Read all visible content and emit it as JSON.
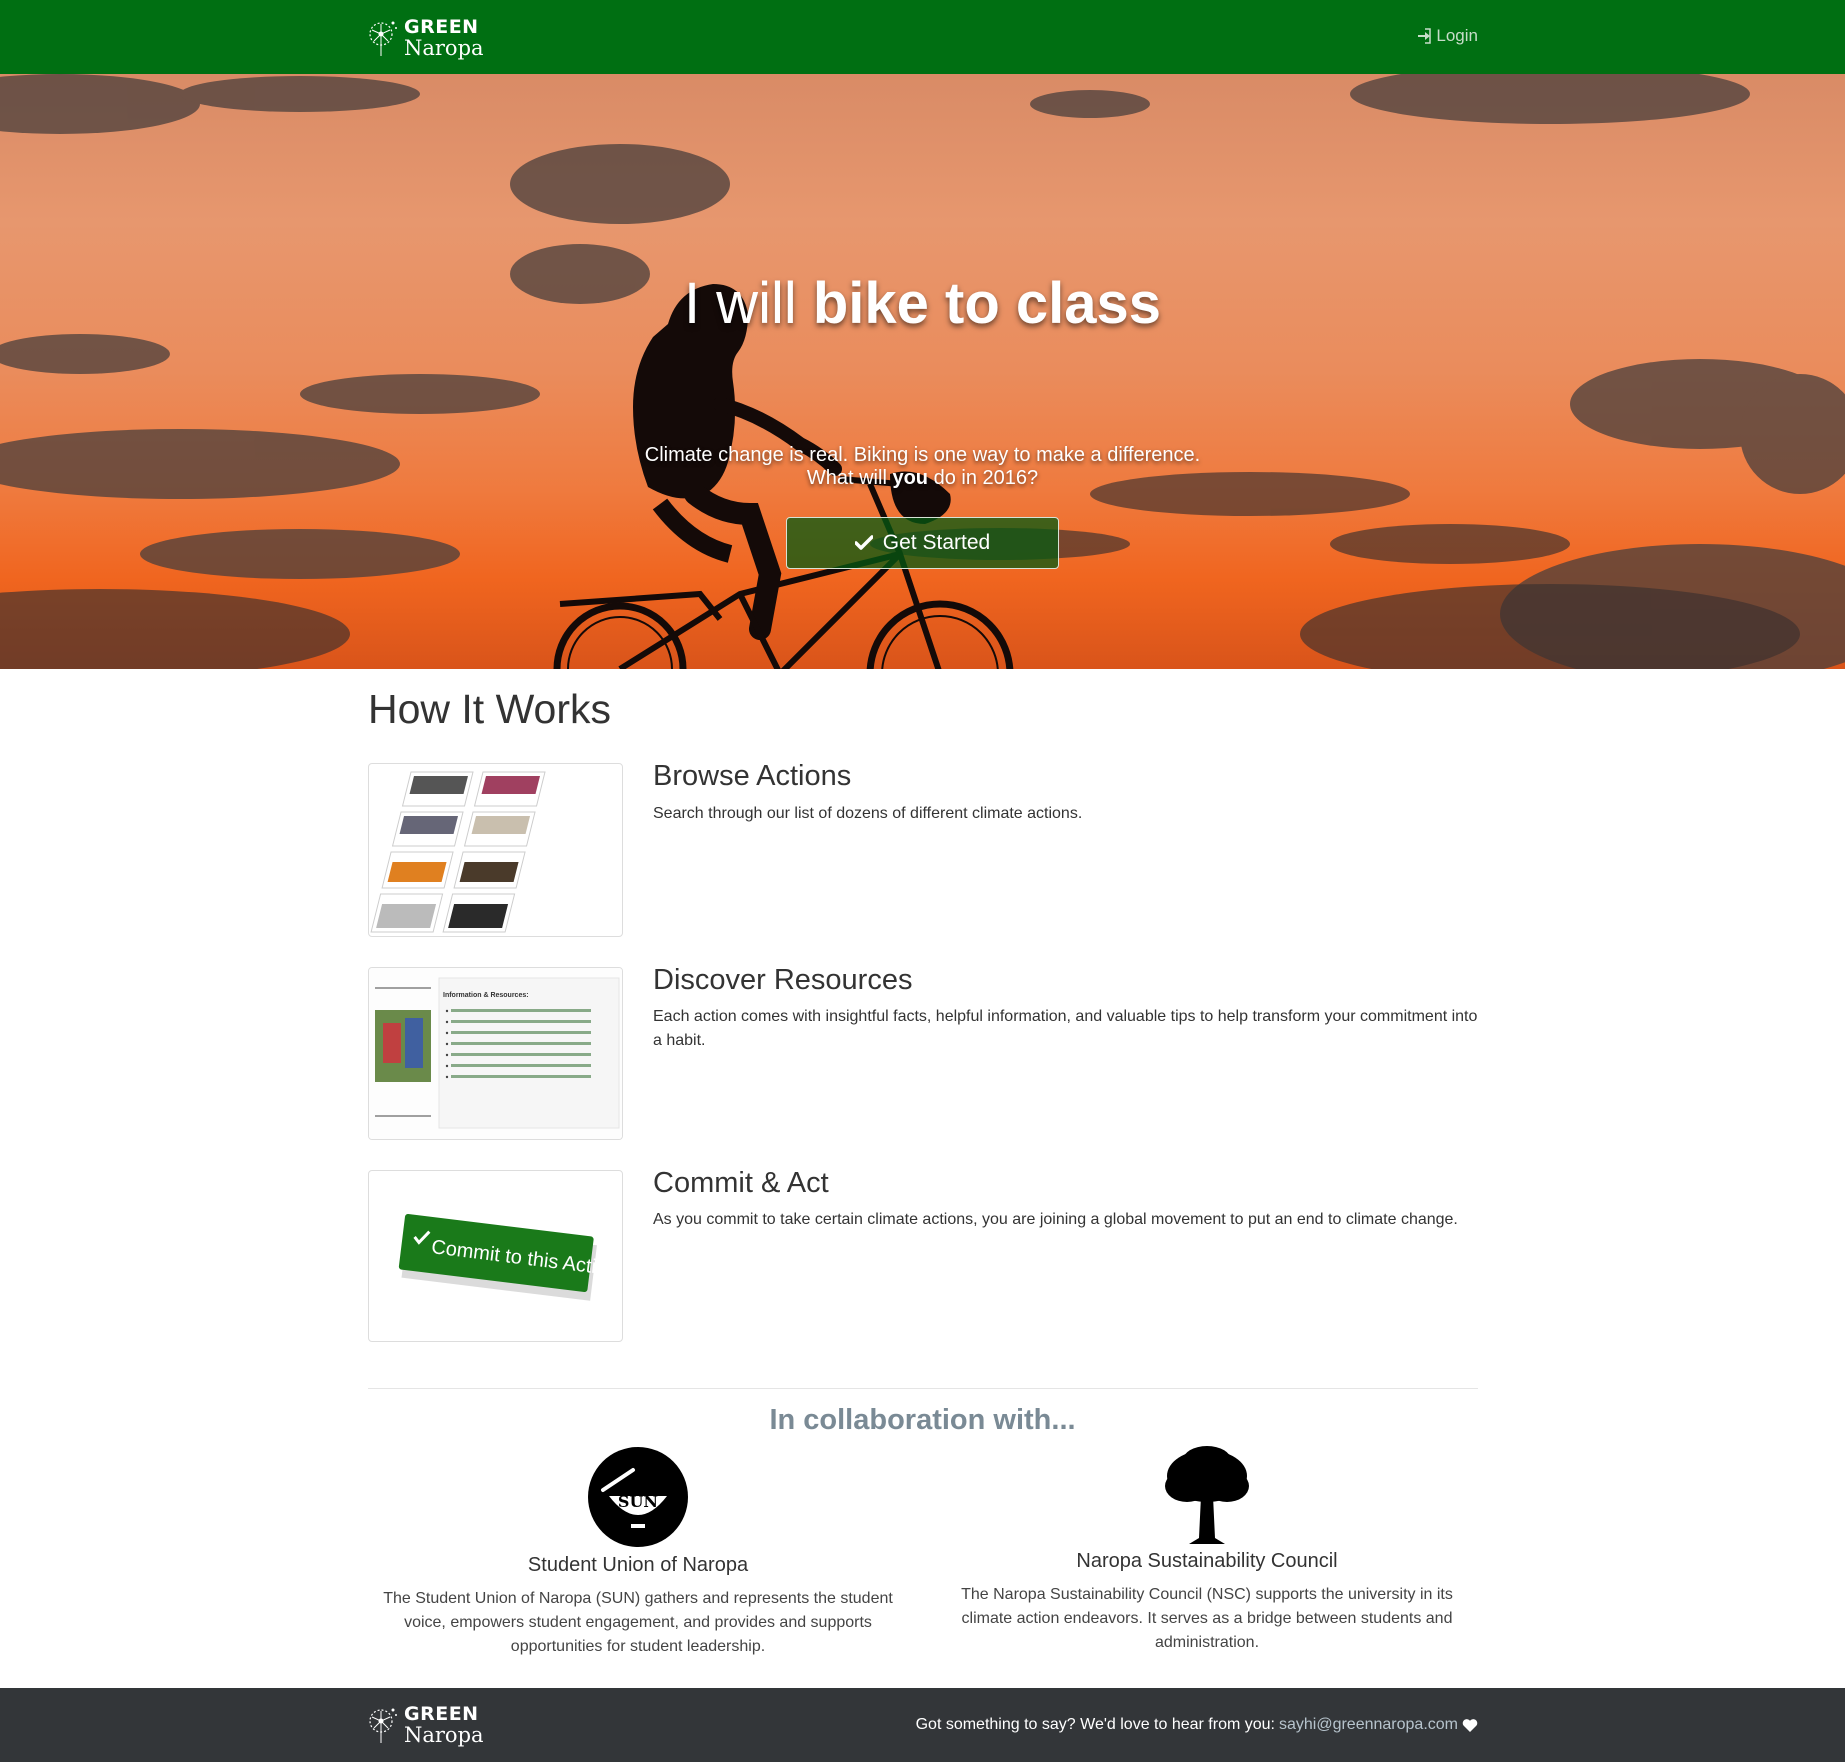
{
  "nav": {
    "brand_line1": "GREEN",
    "brand_line2": "Naropa",
    "login_label": "Login"
  },
  "hero": {
    "title_prefix": "I will",
    "title_action": "bike to class",
    "subtitle_line1": "Climate change is real. Biking is one way to make a difference.",
    "subtitle_line2_a": "What will",
    "subtitle_line2_b": "you",
    "subtitle_line2_c": "do in 2016?",
    "cta_label": "Get Started"
  },
  "how": {
    "title": "How It Works",
    "steps": [
      {
        "title": "Browse Actions",
        "text": "Search through our list of dozens of different climate actions."
      },
      {
        "title": "Discover Resources",
        "text": "Each action comes with insightful facts, helpful information, and valuable tips to help transform your commitment into a habit."
      },
      {
        "title": "Commit & Act",
        "text": "As you commit to take certain climate actions, you are joining a global movement to put an end to climate change."
      }
    ],
    "screenshot_heading": "Information & Resources:",
    "commit_button_label": "Commit to this Action"
  },
  "collab": {
    "title": "In collaboration with...",
    "partners": [
      {
        "name": "Student Union of Naropa",
        "desc": "The Student Union of Naropa (SUN) gathers and represents the student voice, empowers student engagement, and provides and supports opportunities for student leadership.",
        "logo_text": "SUN"
      },
      {
        "name": "Naropa Sustainability Council",
        "desc": "The Naropa Sustainability Council (NSC) supports the university in its climate action endeavors. It serves as a bridge between students and administration."
      }
    ]
  },
  "footer": {
    "message": "Got something to say? We'd love to hear from you:",
    "email": "sayhi@greennaropa.com"
  },
  "colors": {
    "nav_green": "#006f12",
    "footer_dark": "#333639",
    "cta_green": "#065a12"
  }
}
